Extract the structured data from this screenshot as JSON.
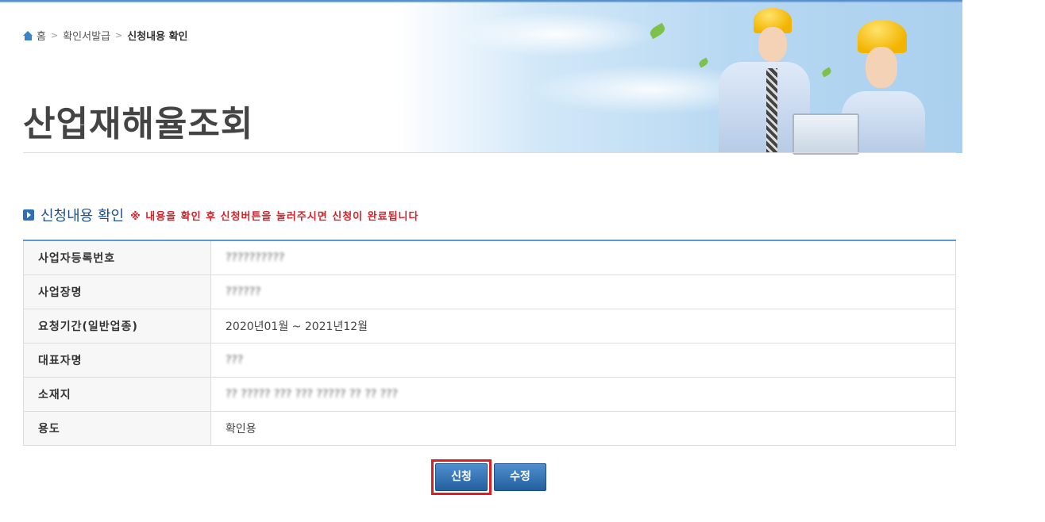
{
  "breadcrumb": {
    "home": "홈",
    "level1": "확인서발급",
    "current": "신청내용 확인"
  },
  "page_title": "산업재해율조회",
  "section": {
    "title": "신청내용 확인",
    "notice": "※ 내용을 확인 후 신청버튼을 눌러주시면 신청이 완료됩니다"
  },
  "rows": [
    {
      "label": "사업자등록번호",
      "value": "??????????",
      "redacted": true
    },
    {
      "label": "사업장명",
      "value": "??????",
      "redacted": true
    },
    {
      "label": "요청기간(일반업종)",
      "value": "2020년01월 ~ 2021년12월",
      "redacted": false
    },
    {
      "label": "대표자명",
      "value": "???",
      "redacted": true
    },
    {
      "label": "소재지",
      "value": "?? ????? ??? ??? ????? ?? ?? ???",
      "redacted": true
    },
    {
      "label": "용도",
      "value": "확인용",
      "redacted": false
    }
  ],
  "buttons": {
    "apply": "신청",
    "edit": "수정"
  },
  "colors": {
    "accent": "#2f6fb5",
    "notice": "#d2232a",
    "highlight": "#e01b24"
  }
}
